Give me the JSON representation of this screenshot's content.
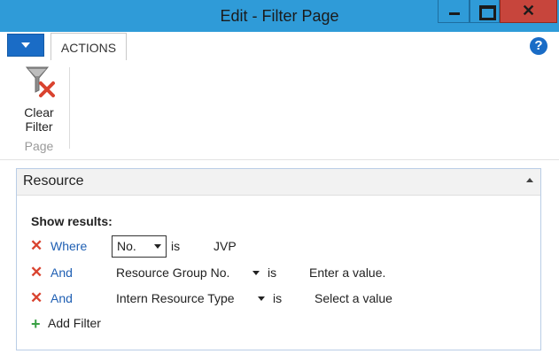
{
  "window": {
    "title": "Edit - Filter Page",
    "minimize_icon": "minimize-icon",
    "maximize_icon": "maximize-icon",
    "close_glyph": "✕"
  },
  "ribbon": {
    "tab_label": "ACTIONS",
    "help_glyph": "?",
    "clear_filter": {
      "line1": "Clear",
      "line2": "Filter",
      "icon": "clear-filter-icon"
    },
    "group_label": "Page"
  },
  "panel": {
    "title": "Resource",
    "show_results_label": "Show results:",
    "rows": [
      {
        "conjunction": "Where",
        "field": "No.",
        "operator": "is",
        "value": "JVP"
      },
      {
        "conjunction": "And",
        "field": "Resource Group No.",
        "operator": "is",
        "value": "Enter a value."
      },
      {
        "conjunction": "And",
        "field": "Intern Resource Type",
        "operator": "is",
        "value": "Select a value"
      }
    ],
    "add_filter_label": "Add Filter"
  },
  "colors": {
    "titlebar": "#2f9bd8",
    "close_button": "#c7453c",
    "accent": "#1a6cc6",
    "remove": "#d9432f",
    "add": "#38a043"
  }
}
